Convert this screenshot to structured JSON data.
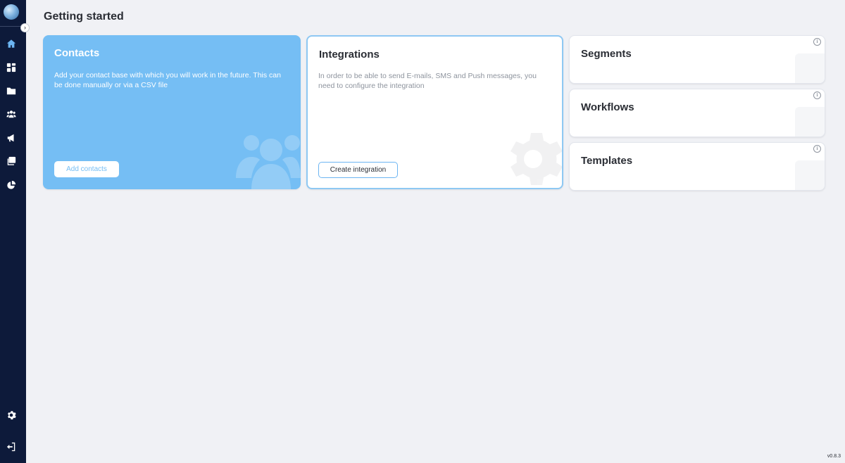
{
  "page": {
    "title": "Getting started",
    "version": "v0.8.3"
  },
  "sidebar": {
    "items": [
      {
        "icon": "home-icon",
        "active": true
      },
      {
        "icon": "dashboard-icon"
      },
      {
        "icon": "folder-icon"
      },
      {
        "icon": "users-icon"
      },
      {
        "icon": "megaphone-icon"
      },
      {
        "icon": "templates-icon"
      },
      {
        "icon": "analytics-icon"
      }
    ],
    "bottom_items": [
      {
        "icon": "gear-icon"
      },
      {
        "icon": "logout-icon"
      }
    ]
  },
  "cards": {
    "contacts": {
      "title": "Contacts",
      "description": "Add your contact base with which you will work in the future. This can be done manually or via a CSV file",
      "button": "Add contacts"
    },
    "integrations": {
      "title": "Integrations",
      "description": "In order to be able to send E-mails, SMS and Push messages, you need to configure the integration",
      "button": "Create integration"
    },
    "segments": {
      "title": "Segments",
      "info": "i"
    },
    "workflows": {
      "title": "Workflows",
      "info": "i"
    },
    "templates": {
      "title": "Templates",
      "info": "i"
    }
  },
  "colors": {
    "sidebar": "#0d1a3a",
    "accent": "#75bef4",
    "background": "#f0f1f5"
  }
}
